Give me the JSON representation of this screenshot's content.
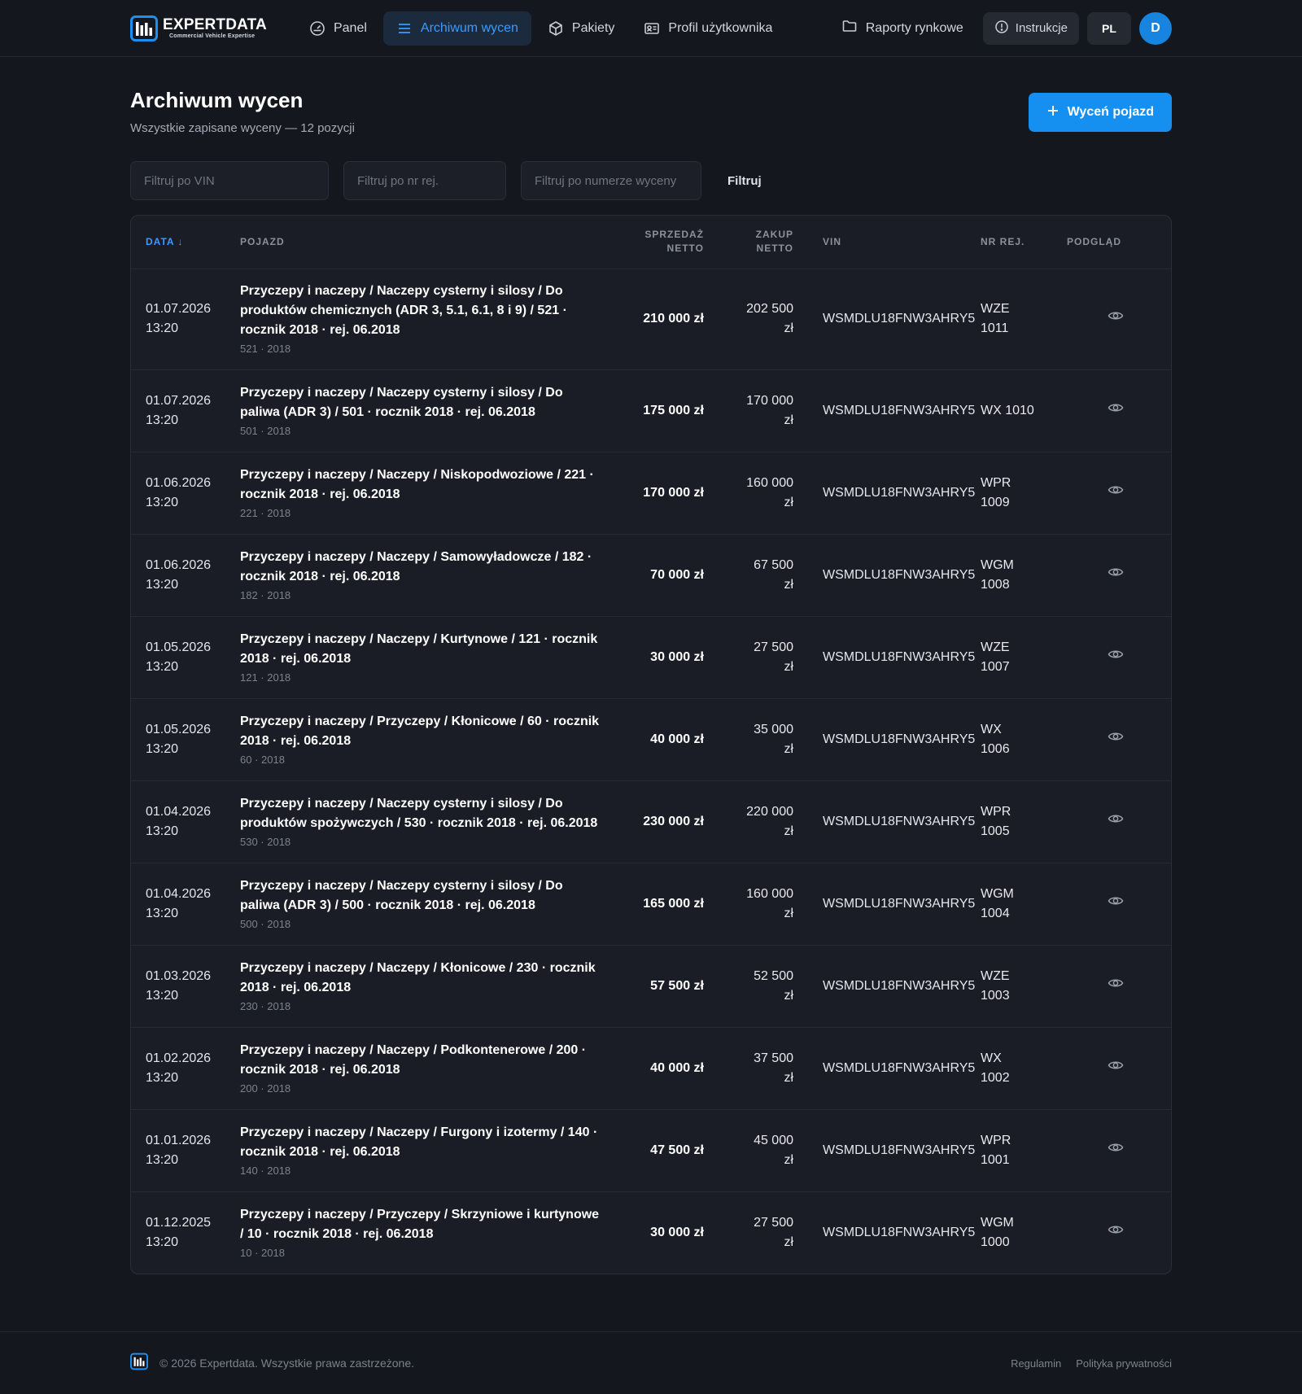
{
  "brand": {
    "name": "EXPERTDATA",
    "tagline": "Commercial Vehicle Expertise"
  },
  "nav": {
    "items": [
      {
        "label": "Panel",
        "icon": "gauge-icon"
      },
      {
        "label": "Archiwum wycen",
        "icon": "list-icon",
        "active": true
      },
      {
        "label": "Pakiety",
        "icon": "box-icon"
      },
      {
        "label": "Profil użytkownika",
        "icon": "id-card-icon"
      }
    ],
    "reports_label": "Raporty rynkowe",
    "instructions_label": "Instrukcje",
    "lang": "PL",
    "avatar_initial": "D"
  },
  "page": {
    "title": "Archiwum wycen",
    "subtitle": "Wszystkie zapisane wyceny — 12 pozycji",
    "new_button": "Wyceń pojazd"
  },
  "filters": {
    "vin_placeholder": "Filtruj po VIN",
    "reg_placeholder": "Filtruj po nr rej.",
    "number_placeholder": "Filtruj po numerze wyceny",
    "button": "Filtruj"
  },
  "table": {
    "columns": {
      "date": "DATA ↓",
      "vehicle": "POJAZD",
      "sale_1": "SPRZEDAŻ",
      "sale_2": "NETTO",
      "buy_1": "ZAKUP",
      "buy_2": "NETTO",
      "vin": "VIN",
      "reg": "NR REJ.",
      "preview": "PODGLĄD"
    },
    "rows": [
      {
        "date": "01.07.2026",
        "time": "13:20",
        "title": "Przyczepy i naczepy / Naczepy cysterny i silosy / Do produktów chemicznych (ADR 3, 5.1, 6.1, 8 i 9) / 521 · rocznik 2018 · rej. 06.2018",
        "sub": "521 · 2018",
        "sale": "210 000 zł",
        "buy_1": "202 500",
        "buy_2": "zł",
        "vin": "WSMDLU18FNW3AHRY5",
        "reg_1": "WZE",
        "reg_2": "1011"
      },
      {
        "date": "01.07.2026",
        "time": "13:20",
        "title": "Przyczepy i naczepy / Naczepy cysterny i silosy / Do paliwa (ADR 3) / 501 · rocznik 2018 · rej. 06.2018",
        "sub": "501 · 2018",
        "sale": "175 000 zł",
        "buy_1": "170 000",
        "buy_2": "zł",
        "vin": "WSMDLU18FNW3AHRY5",
        "reg_1": "WX 1010",
        "reg_2": ""
      },
      {
        "date": "01.06.2026",
        "time": "13:20",
        "title": "Przyczepy i naczepy / Naczepy / Niskopodwoziowe / 221 · rocznik 2018 · rej. 06.2018",
        "sub": "221 · 2018",
        "sale": "170 000 zł",
        "buy_1": "160 000",
        "buy_2": "zł",
        "vin": "WSMDLU18FNW3AHRY5",
        "reg_1": "WPR",
        "reg_2": "1009"
      },
      {
        "date": "01.06.2026",
        "time": "13:20",
        "title": "Przyczepy i naczepy / Naczepy / Samowyładowcze / 182 · rocznik 2018 · rej. 06.2018",
        "sub": "182 · 2018",
        "sale": "70 000 zł",
        "buy_1": "67 500",
        "buy_2": "zł",
        "vin": "WSMDLU18FNW3AHRY5",
        "reg_1": "WGM",
        "reg_2": "1008"
      },
      {
        "date": "01.05.2026",
        "time": "13:20",
        "title": "Przyczepy i naczepy / Naczepy / Kurtynowe / 121 · rocznik 2018 · rej. 06.2018",
        "sub": "121 · 2018",
        "sale": "30 000 zł",
        "buy_1": "27 500",
        "buy_2": "zł",
        "vin": "WSMDLU18FNW3AHRY5",
        "reg_1": "WZE",
        "reg_2": "1007"
      },
      {
        "date": "01.05.2026",
        "time": "13:20",
        "title": "Przyczepy i naczepy / Przyczepy / Kłonicowe / 60 · rocznik 2018 · rej. 06.2018",
        "sub": "60 · 2018",
        "sale": "40 000 zł",
        "buy_1": "35 000",
        "buy_2": "zł",
        "vin": "WSMDLU18FNW3AHRY5",
        "reg_1": "WX",
        "reg_2": "1006"
      },
      {
        "date": "01.04.2026",
        "time": "13:20",
        "title": "Przyczepy i naczepy / Naczepy cysterny i silosy / Do produktów spożywczych / 530 · rocznik 2018 · rej. 06.2018",
        "sub": "530 · 2018",
        "sale": "230 000 zł",
        "buy_1": "220 000",
        "buy_2": "zł",
        "vin": "WSMDLU18FNW3AHRY5",
        "reg_1": "WPR",
        "reg_2": "1005"
      },
      {
        "date": "01.04.2026",
        "time": "13:20",
        "title": "Przyczepy i naczepy / Naczepy cysterny i silosy / Do paliwa (ADR 3) / 500 · rocznik 2018 · rej. 06.2018",
        "sub": "500 · 2018",
        "sale": "165 000 zł",
        "buy_1": "160 000",
        "buy_2": "zł",
        "vin": "WSMDLU18FNW3AHRY5",
        "reg_1": "WGM",
        "reg_2": "1004"
      },
      {
        "date": "01.03.2026",
        "time": "13:20",
        "title": "Przyczepy i naczepy / Naczepy / Kłonicowe / 230 · rocznik 2018 · rej. 06.2018",
        "sub": "230 · 2018",
        "sale": "57 500 zł",
        "buy_1": "52 500",
        "buy_2": "zł",
        "vin": "WSMDLU18FNW3AHRY5",
        "reg_1": "WZE",
        "reg_2": "1003"
      },
      {
        "date": "01.02.2026",
        "time": "13:20",
        "title": "Przyczepy i naczepy / Naczepy / Podkontenerowe / 200 · rocznik 2018 · rej. 06.2018",
        "sub": "200 · 2018",
        "sale": "40 000 zł",
        "buy_1": "37 500",
        "buy_2": "zł",
        "vin": "WSMDLU18FNW3AHRY5",
        "reg_1": "WX",
        "reg_2": "1002"
      },
      {
        "date": "01.01.2026",
        "time": "13:20",
        "title": "Przyczepy i naczepy / Naczepy / Furgony i izotermy / 140 · rocznik 2018 · rej. 06.2018",
        "sub": "140 · 2018",
        "sale": "47 500 zł",
        "buy_1": "45 000",
        "buy_2": "zł",
        "vin": "WSMDLU18FNW3AHRY5",
        "reg_1": "WPR",
        "reg_2": "1001"
      },
      {
        "date": "01.12.2025",
        "time": "13:20",
        "title": "Przyczepy i naczepy / Przyczepy / Skrzyniowe i kurtynowe / 10 · rocznik 2018 · rej. 06.2018",
        "sub": "10 · 2018",
        "sale": "30 000 zł",
        "buy_1": "27 500",
        "buy_2": "zł",
        "vin": "WSMDLU18FNW3AHRY5",
        "reg_1": "WGM",
        "reg_2": "1000"
      }
    ]
  },
  "footer": {
    "copyright": "© 2026 Expertdata. Wszystkie prawa zastrzeżone.",
    "terms": "Regulamin",
    "privacy": "Polityka prywatności"
  },
  "colors": {
    "background": "#14171e",
    "accent": "#1690f0",
    "active_nav": "#3b9bff"
  }
}
